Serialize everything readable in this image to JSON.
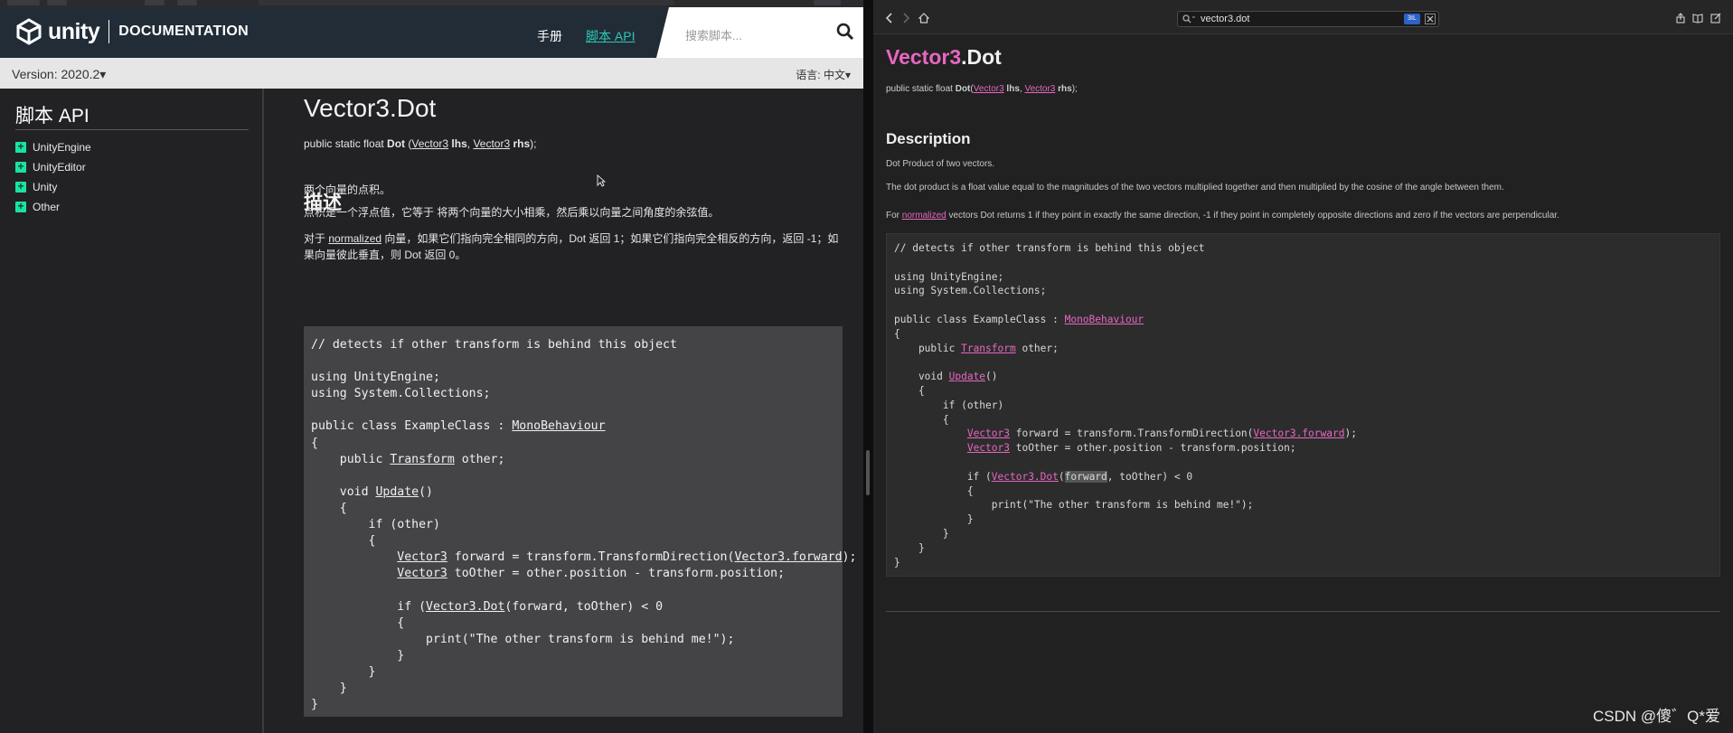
{
  "left": {
    "logo_word": "unity",
    "logo_doc": "DOCUMENTATION",
    "nav": {
      "manual": "手册",
      "script_api": "脚本 API"
    },
    "search_placeholder": "搜索脚本...",
    "version": "Version: 2020.2",
    "language": "语言: 中文",
    "sidebar": {
      "title": "脚本 API",
      "items": [
        "UnityEngine",
        "UnityEditor",
        "Unity",
        "Other"
      ]
    },
    "title": "Vector3.Dot",
    "signature": {
      "prefix": "public static float ",
      "name": "Dot",
      "open": " (",
      "type1": "Vector3",
      "arg1": " lhs",
      "comma": ", ",
      "type2": "Vector3",
      "arg2": " rhs",
      "close": ");"
    },
    "section": "描述",
    "p1": "两个向量的点积。",
    "p2": "点积是一个浮点值，它等于 将两个向量的大小相乘，然后乘以向量之间角度的余弦值。",
    "p3": {
      "pre": "对于 ",
      "link": "normalized",
      "post": " 向量，如果它们指向完全相同的方向，Dot 返回 1；如果它们指向完全相反的方向，返回 -1；如果向量彼此垂直，则 Dot 返回 0。"
    }
  },
  "code": {
    "l1": "// detects if other transform is behind this object",
    "l3": "using UnityEngine;",
    "l4": "using System.Collections;",
    "l6a": "public class ExampleClass : ",
    "mono": "MonoBehaviour",
    "l7": "{",
    "l8a": "    public ",
    "transform": "Transform",
    "l8b": " other;",
    "l10a": "    void ",
    "update": "Update",
    "l10b": "()",
    "l11": "    {",
    "l12": "        if (other)",
    "l13": "        {",
    "indent3": "            ",
    "vector3": "Vector3",
    "l14b": " forward = transform.TransformDirection(",
    "v3fwd": "Vector3.forward",
    "l14c": ");",
    "l15b": " toOther = other.position - transform.position;",
    "l17a": "            if (",
    "v3dot": "Vector3.Dot",
    "l17b": "(forward, toOther) < 0",
    "l17b_pre": "(",
    "l17b_hl": "forward",
    "l17b_post": ", toOther) < 0",
    "l18": "            {",
    "l19": "                print(\"The other transform is behind me!\");",
    "l20": "            }",
    "l21": "        }",
    "l22": "    }",
    "l23": "}"
  },
  "right": {
    "search_value": "vector3.dot",
    "badge": "3IL",
    "title_pink": "Vector3",
    "title_rest": ".Dot",
    "signature": {
      "prefix": "public static float ",
      "name": "Dot",
      "open": "(",
      "type1": "Vector3",
      "arg1": " lhs",
      "comma": ", ",
      "type2": "Vector3",
      "arg2": " rhs",
      "close": ");"
    },
    "section": "Description",
    "p1": "Dot Product of two vectors.",
    "p2": "The dot product is a float value equal to the magnitudes of the two vectors multiplied together and then multiplied by the cosine of the angle between them.",
    "p3": {
      "pre": "For ",
      "link": "normalized",
      "post": " vectors Dot returns 1 if they point in exactly the same direction, -1 if they point in completely opposite directions and zero if the vectors are perpendicular."
    }
  },
  "watermark": "CSDN @傻゛Q*爱"
}
